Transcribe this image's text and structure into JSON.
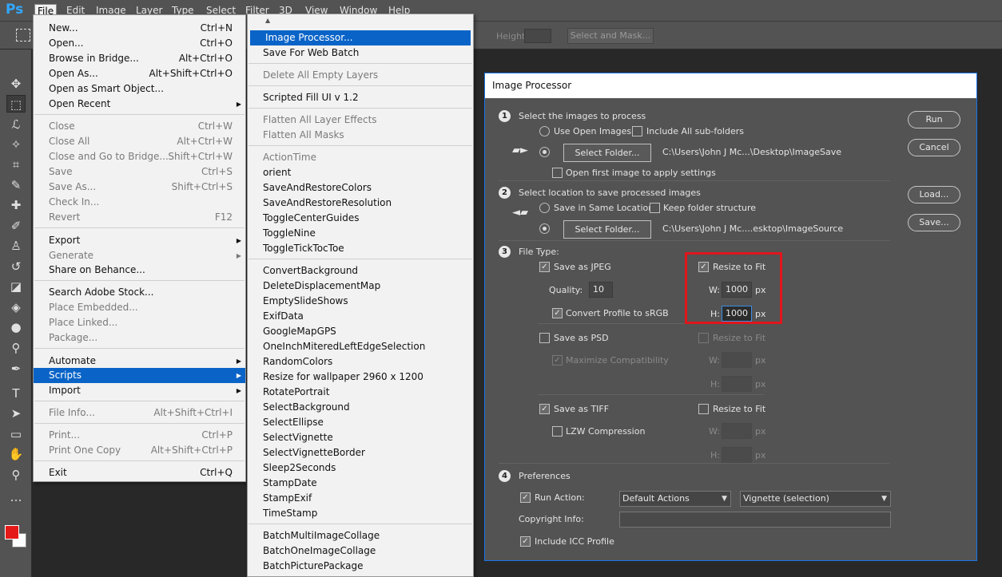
{
  "app": {
    "logo": "Ps"
  },
  "menubar": [
    "File",
    "Edit",
    "Image",
    "Layer",
    "Type",
    "Select",
    "Filter",
    "3D",
    "View",
    "Window",
    "Help"
  ],
  "options_bar": {
    "height_label": "Height:",
    "select_mask": "Select and Mask..."
  },
  "file_menu": {
    "items": [
      {
        "label": "New...",
        "shortcut": "Ctrl+N"
      },
      {
        "label": "Open...",
        "shortcut": "Ctrl+O"
      },
      {
        "label": "Browse in Bridge...",
        "shortcut": "Alt+Ctrl+O"
      },
      {
        "label": "Open As...",
        "shortcut": "Alt+Shift+Ctrl+O"
      },
      {
        "label": "Open as Smart Object...",
        "shortcut": ""
      },
      {
        "label": "Open Recent",
        "shortcut": ""
      },
      {
        "label": "Close",
        "shortcut": "Ctrl+W"
      },
      {
        "label": "Close All",
        "shortcut": "Alt+Ctrl+W"
      },
      {
        "label": "Close and Go to Bridge...",
        "shortcut": "Shift+Ctrl+W"
      },
      {
        "label": "Save",
        "shortcut": "Ctrl+S"
      },
      {
        "label": "Save As...",
        "shortcut": "Shift+Ctrl+S"
      },
      {
        "label": "Check In...",
        "shortcut": ""
      },
      {
        "label": "Revert",
        "shortcut": "F12"
      },
      {
        "label": "Export",
        "shortcut": ""
      },
      {
        "label": "Generate",
        "shortcut": ""
      },
      {
        "label": "Share on Behance...",
        "shortcut": ""
      },
      {
        "label": "Search Adobe Stock...",
        "shortcut": ""
      },
      {
        "label": "Place Embedded...",
        "shortcut": ""
      },
      {
        "label": "Place Linked...",
        "shortcut": ""
      },
      {
        "label": "Package...",
        "shortcut": ""
      },
      {
        "label": "Automate",
        "shortcut": ""
      },
      {
        "label": "Scripts",
        "shortcut": ""
      },
      {
        "label": "Import",
        "shortcut": ""
      },
      {
        "label": "File Info...",
        "shortcut": "Alt+Shift+Ctrl+I"
      },
      {
        "label": "Print...",
        "shortcut": "Ctrl+P"
      },
      {
        "label": "Print One Copy",
        "shortcut": "Alt+Shift+Ctrl+P"
      },
      {
        "label": "Exit",
        "shortcut": "Ctrl+Q"
      }
    ]
  },
  "scripts_menu": {
    "items": [
      "Image Processor...",
      "Save For Web Batch",
      "Delete All Empty Layers",
      "Scripted Fill UI v 1.2",
      "Flatten All Layer Effects",
      "Flatten All Masks",
      "ActionTime",
      "orient",
      "SaveAndRestoreColors",
      "SaveAndRestoreResolution",
      "ToggleCenterGuides",
      "ToggleNine",
      "ToggleTickTocToe",
      "ConvertBackground",
      "DeleteDisplacementMap",
      "EmptySlideShows",
      "ExifData",
      "GoogleMapGPS",
      "OneInchMiteredLeftEdgeSelection",
      "RandomColors",
      "Resize for wallpaper 2960 x 1200",
      "RotatePortrait",
      "SelectBackground",
      "SelectEllipse",
      "SelectVignette",
      "SelectVignetteBorder",
      "Sleep2Seconds",
      "StampDate",
      "StampExif",
      "TimeStamp",
      "BatchMultiImageCollage",
      "BatchOneImageCollage",
      "BatchPicturePackage"
    ]
  },
  "dialog": {
    "title": "Image Processor",
    "section_numbers": [
      "1",
      "2",
      "3",
      "4"
    ],
    "s1": {
      "heading": "Select the images to process",
      "use_open": "Use Open Images",
      "include_sub": "Include All sub-folders",
      "select_folder": "Select Folder...",
      "path": "C:\\Users\\John J Mc...\\Desktop\\ImageSave",
      "open_first": "Open first image to apply settings"
    },
    "s2": {
      "heading": "Select location to save processed images",
      "same_location": "Save in Same Location",
      "keep_structure": "Keep folder structure",
      "select_folder": "Select Folder...",
      "path": "C:\\Users\\John J Mc....esktop\\ImageSource"
    },
    "s3": {
      "heading": "File Type:",
      "jpeg": "Save as JPEG",
      "resize": "Resize to Fit",
      "quality_label": "Quality:",
      "quality": "10",
      "w_label": "W:",
      "h_label": "H:",
      "px": "px",
      "jpeg_w": "1000",
      "jpeg_h": "1000",
      "convert_srgb": "Convert Profile to sRGB",
      "psd": "Save as PSD",
      "max_compat": "Maximize Compatibility",
      "tiff": "Save as TIFF",
      "lzw": "LZW Compression"
    },
    "s4": {
      "heading": "Preferences",
      "run_action": "Run Action:",
      "action_set": "Default Actions",
      "action": "Vignette (selection)",
      "copyright": "Copyright Info:",
      "icc": "Include ICC Profile"
    },
    "buttons": {
      "run": "Run",
      "cancel": "Cancel",
      "load": "Load...",
      "save": "Save..."
    }
  },
  "colors": {
    "accent": "#0a64c8",
    "highlight": "#e0151b",
    "foreground": "#e61919",
    "background": "#ffffff"
  }
}
